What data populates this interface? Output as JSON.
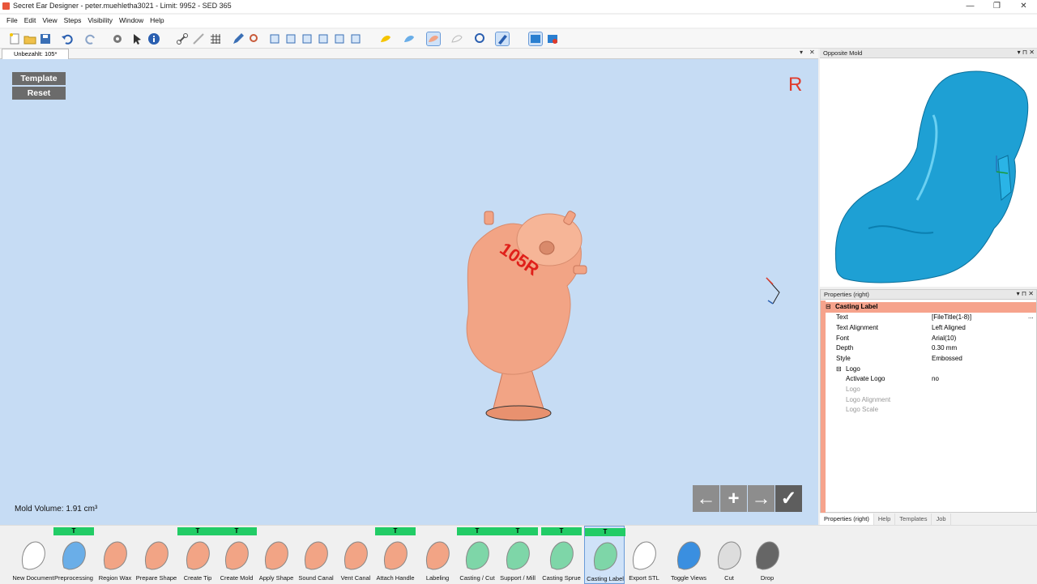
{
  "window": {
    "title": "Secret Ear Designer - peter.muehletha3021 - Limit: 9952 - SED 365",
    "controls": [
      "—",
      "❐",
      "✕"
    ]
  },
  "menu": [
    "File",
    "Edit",
    "View",
    "Steps",
    "Visibility",
    "Window",
    "Help"
  ],
  "document_tab": {
    "label": "Unbezahlt: 105*",
    "controls": [
      "▾",
      "✕"
    ]
  },
  "viewport": {
    "template_button": "Template",
    "reset_button": "Reset",
    "side_indicator": "R",
    "model_label": "105R",
    "mold_volume": "Mold Volume: 1.91 cm³",
    "nav": {
      "back": "←",
      "add": "+",
      "forward": "→",
      "confirm": "✓"
    },
    "colors": {
      "background": "#c6dcf4",
      "model": "#f2a485",
      "label_text": "#e0201a"
    }
  },
  "opposite_mold": {
    "title": "Opposite Mold",
    "controls": "▾ ⊓ ✕",
    "model_color": "#1ea0d4"
  },
  "properties": {
    "title": "Properties (right)",
    "controls": "▾ ⊓ ✕",
    "section": "Casting Label",
    "section_toggle": "⊟",
    "rows": [
      {
        "key": "Text",
        "value": "[FileTitle(1-8)]",
        "extra": "..."
      },
      {
        "key": "Text Alignment",
        "value": "Left Aligned"
      },
      {
        "key": "Font",
        "value": "Arial(10)"
      },
      {
        "key": "Depth",
        "value": "0.30 mm"
      },
      {
        "key": "Style",
        "value": "Embossed"
      }
    ],
    "logo_section": "Logo",
    "logo_rows": [
      {
        "key": "Activate Logo",
        "value": "no"
      },
      {
        "key": "Logo",
        "value": ""
      },
      {
        "key": "Logo Alignment",
        "value": ""
      },
      {
        "key": "Logo Scale",
        "value": ""
      }
    ],
    "tabs": [
      "Properties (right)",
      "Help",
      "Templates",
      "Job"
    ]
  },
  "workflow": {
    "tmark": "T",
    "steps": [
      {
        "label": "New Document",
        "template": false,
        "icon": "new-document-icon"
      },
      {
        "label": "Preprocessing",
        "template": true,
        "icon": "preprocessing-icon"
      },
      {
        "label": "Region Wax",
        "template": false,
        "icon": "region-wax-icon"
      },
      {
        "label": "Prepare Shape",
        "template": false,
        "icon": "prepare-shape-icon"
      },
      {
        "label": "Create Tip",
        "template": true,
        "icon": "create-tip-icon"
      },
      {
        "label": "Create Mold",
        "template": true,
        "icon": "create-mold-icon"
      },
      {
        "label": "Apply Shape",
        "template": false,
        "icon": "apply-shape-icon"
      },
      {
        "label": "Sound Canal",
        "template": false,
        "icon": "sound-canal-icon"
      },
      {
        "label": "Vent Canal",
        "template": false,
        "icon": "vent-canal-icon"
      },
      {
        "label": "Attach Handle",
        "template": true,
        "icon": "attach-handle-icon"
      },
      {
        "label": "Labeling",
        "template": false,
        "icon": "labeling-icon"
      },
      {
        "label": "Casting / Cut",
        "template": true,
        "icon": "casting-cut-icon"
      },
      {
        "label": "Support / Mill",
        "template": true,
        "icon": "support-mill-icon"
      },
      {
        "label": "Casting Sprue",
        "template": true,
        "icon": "casting-sprue-icon"
      },
      {
        "label": "Casting Label",
        "template": true,
        "active": true,
        "icon": "casting-label-icon"
      },
      {
        "label": "Export STL",
        "template": false,
        "icon": "export-stl-icon"
      },
      {
        "label": "Toggle Views",
        "template": false,
        "icon": "toggle-views-icon"
      },
      {
        "label": "Cut",
        "template": false,
        "icon": "cut-icon"
      },
      {
        "label": "Drop",
        "template": false,
        "icon": "drop-icon"
      }
    ]
  }
}
